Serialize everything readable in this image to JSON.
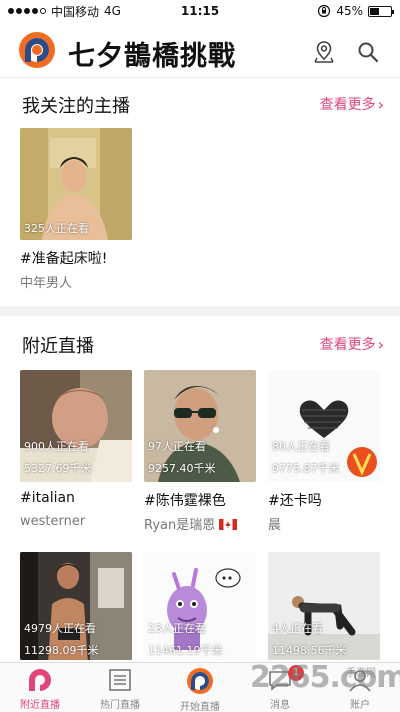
{
  "status_bar": {
    "carrier": "中国移动",
    "network": "4G",
    "time": "11:15",
    "battery": "45%",
    "battery_level": 0.45
  },
  "header": {
    "title": "七夕鵲橋挑戰"
  },
  "followed": {
    "title": "我关注的主播",
    "more": "查看更多",
    "items": [
      {
        "viewers": "325人正在看",
        "title": "#准备起床啦!",
        "subtitle": "中年男人"
      }
    ]
  },
  "nearby": {
    "title": "附近直播",
    "more": "查看更多",
    "items": [
      {
        "viewers": "900人正在看",
        "distance": "5327.69千米",
        "title": "#italian",
        "subtitle": "westerner"
      },
      {
        "viewers": "97人正在看",
        "distance": "9257.40千米",
        "title": "#陈伟霆裸色",
        "subtitle": "Ryan是瑞恩"
      },
      {
        "viewers": "80人正在看",
        "distance": "9775.87千米",
        "title": "#还卡吗",
        "subtitle": "晨"
      },
      {
        "viewers": "4979人正在看",
        "distance": "11298.09千米"
      },
      {
        "viewers": "23人正在看",
        "distance": "11461.19千米"
      },
      {
        "viewers": "4人正在看",
        "distance": "11498.56千米"
      }
    ]
  },
  "tabs": [
    {
      "label": "附近直播",
      "icon": "p-logo-icon"
    },
    {
      "label": "热门直播",
      "icon": "list-icon"
    },
    {
      "label": "开始直播",
      "icon": "broadcast-icon"
    },
    {
      "label": "消息",
      "icon": "message-icon",
      "badge": "1"
    },
    {
      "label": "账户",
      "icon": "account-icon"
    }
  ],
  "watermark": {
    "text": "2265.com",
    "sub": "手游网"
  },
  "colors": {
    "accent": "#e2447a",
    "logo_orange": "#f26b21",
    "logo_blue": "#2d4b86"
  }
}
